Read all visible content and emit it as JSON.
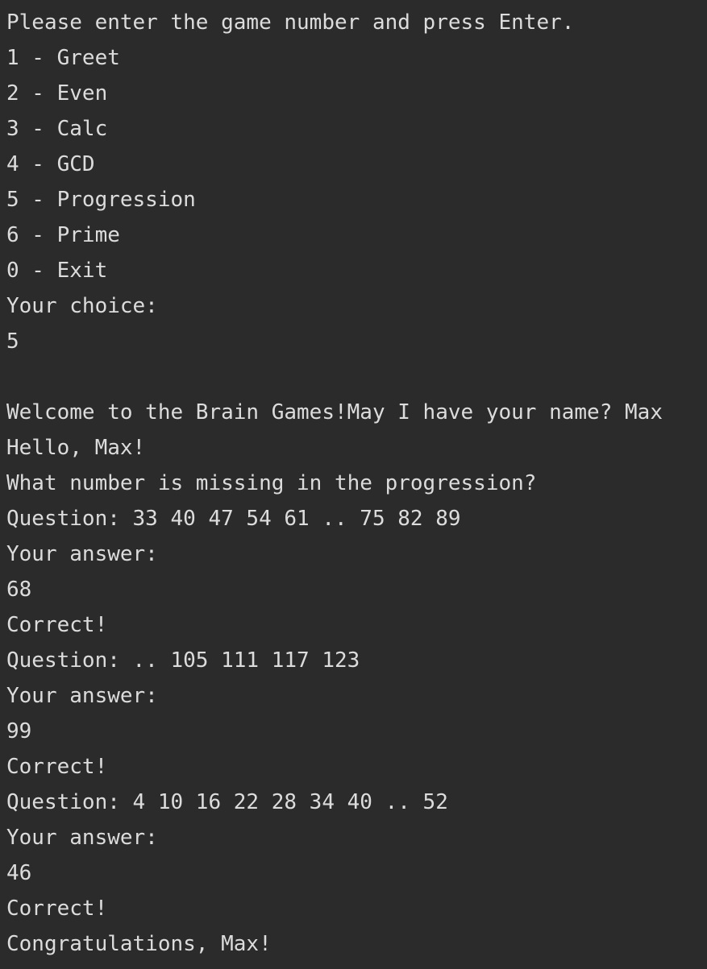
{
  "console": {
    "lines": [
      "Please enter the game number and press Enter.",
      "1 - Greet",
      "2 - Even",
      "3 - Calc",
      "4 - GCD",
      "5 - Progression",
      "6 - Prime",
      "0 - Exit",
      "Your choice:",
      "5",
      "",
      "Welcome to the Brain Games!May I have your name? Max",
      "Hello, Max!",
      "What number is missing in the progression?",
      "Question: 33 40 47 54 61 .. 75 82 89",
      "Your answer:",
      "68",
      "Correct!",
      "Question: .. 105 111 117 123",
      "Your answer:",
      "99",
      "Correct!",
      "Question: 4 10 16 22 28 34 40 .. 52",
      "Your answer:",
      "46",
      "Correct!",
      "Congratulations, Max!"
    ]
  },
  "colors": {
    "background": "#2b2b2b",
    "text": "#dcdcdc"
  }
}
